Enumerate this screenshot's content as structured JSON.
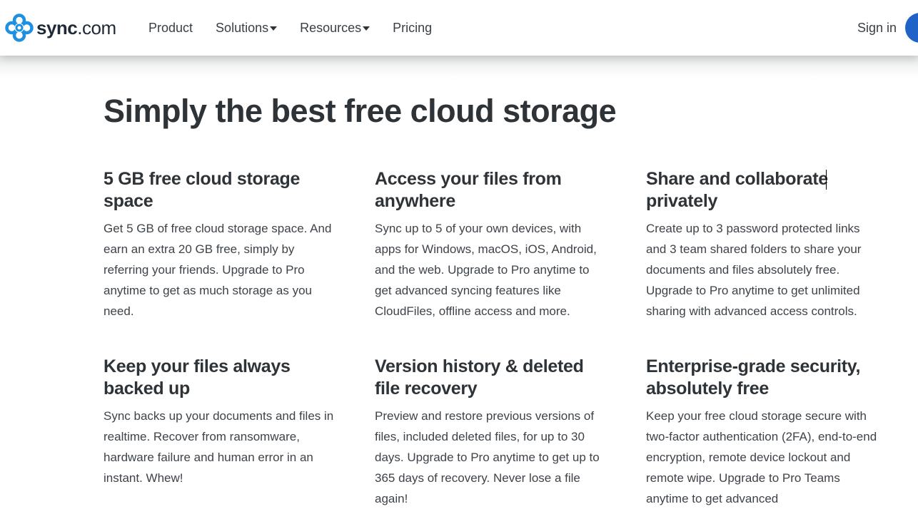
{
  "header": {
    "logo": {
      "brand_bold": "sync",
      "brand_light": ".com",
      "icon": "sync-cloud-logo-icon",
      "color": "#1f8fe0"
    },
    "nav": [
      {
        "label": "Product",
        "dropdown": false
      },
      {
        "label": "Solutions",
        "dropdown": true
      },
      {
        "label": "Resources",
        "dropdown": true
      },
      {
        "label": "Pricing",
        "dropdown": false
      }
    ],
    "sign_in": "Sign in",
    "accent": "#1f63c8"
  },
  "main": {
    "title": "Simply the best free cloud storage",
    "features": [
      {
        "title": "5 GB free cloud storage space",
        "body": "Get 5 GB of free cloud storage space. And earn an extra 20 GB free, simply by referring your friends. Upgrade to Pro anytime to get as much storage as you need."
      },
      {
        "title": "Access your files from anywhere",
        "body": "Sync up to 5 of your own devices, with apps for Windows, macOS, iOS, Android, and the web. Upgrade to Pro anytime to get advanced syncing features like CloudFiles, offline access and more."
      },
      {
        "title": "Share and collaborate privately",
        "body": "Create up to 3 password protected links and 3 team shared folders to share your documents and files absolutely free. Upgrade to Pro anytime to get unlimited sharing with advanced access controls."
      },
      {
        "title": "Keep your files always backed up",
        "body": "Sync backs up your documents and files in realtime. Recover from ransomware, hardware failure and human error in an instant. Whew!"
      },
      {
        "title": "Version history & deleted file recovery",
        "body": "Preview and restore previous versions of files, included deleted files, for up to 30 days. Upgrade to Pro anytime to get up to 365 days of recovery. Never lose a file again!"
      },
      {
        "title": "Enterprise-grade security, absolutely free",
        "body": "Keep your free cloud storage secure with two-factor authentication (2FA), end-to-end encryption, remote device lockout and remote wipe. Upgrade to Pro Teams anytime to get advanced"
      }
    ]
  }
}
